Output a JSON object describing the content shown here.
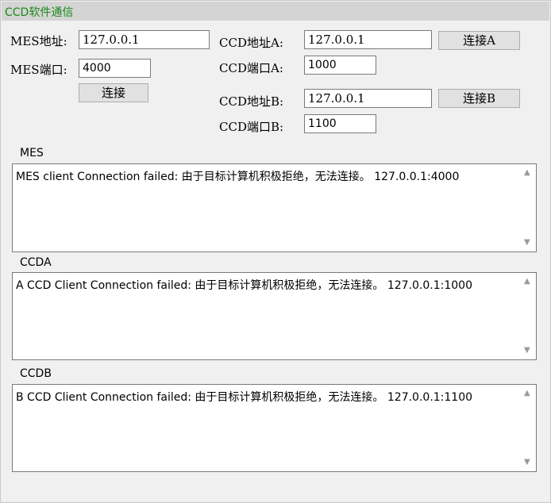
{
  "window": {
    "title": "CCD软件通信"
  },
  "mes": {
    "address_label": "MES地址:",
    "address_value": "127.0.0.1",
    "port_label": "MES端口:",
    "port_value": "4000",
    "connect_label": "连接"
  },
  "ccd_a": {
    "address_label": "CCD地址A:",
    "address_value": "127.0.0.1",
    "port_label": "CCD端口A:",
    "port_value": "1000",
    "connect_label": "连接A"
  },
  "ccd_b": {
    "address_label": "CCD地址B:",
    "address_value": "127.0.0.1",
    "port_label": "CCD端口B:",
    "port_value": "1100",
    "connect_label": "连接B"
  },
  "logs": {
    "mes": {
      "label": "MES",
      "text": "MES client Connection failed: 由于目标计算机积极拒绝，无法连接。 127.0.0.1:4000"
    },
    "ccda": {
      "label": "CCDA",
      "text": "A CCD Client Connection failed: 由于目标计算机积极拒绝，无法连接。 127.0.0.1:1000"
    },
    "ccdb": {
      "label": "CCDB",
      "text": "B CCD Client Connection failed: 由于目标计算机积极拒绝，无法连接。 127.0.0.1:1100"
    }
  },
  "icons": {
    "scroll_up": "▲",
    "scroll_down": "▼"
  },
  "colors": {
    "title_text": "#1a8a1a",
    "title_bar": "#d4d4d4",
    "background": "#f0f0f0"
  }
}
